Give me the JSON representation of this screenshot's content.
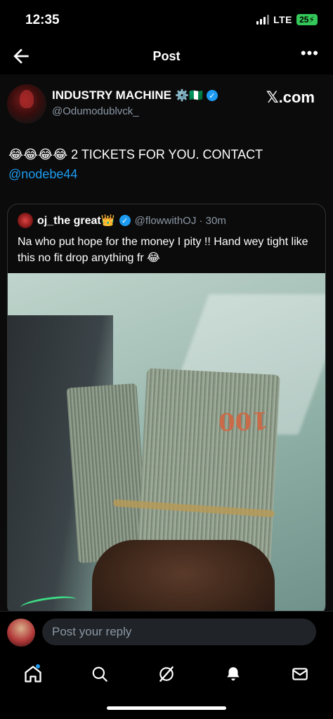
{
  "status_bar": {
    "time": "12:35",
    "network": "LTE",
    "battery": "25"
  },
  "nav": {
    "title": "Post"
  },
  "post": {
    "display_name": "INDUSTRY MACHINE",
    "name_emojis": "⚙️🇳🇬",
    "handle": "@Odumodublvck_",
    "watermark": "𝕏.com",
    "text": "😂😂😂😂 2 TICKETS FOR YOU. CONTACT",
    "mention": "@nodebe44"
  },
  "quote": {
    "name": "oj_the great👑",
    "handle_time": "@flowwithOJ · 30m",
    "text": "Na who put hope for the money I pity !! Hand wey tight like this no fit drop anything fr 😂",
    "bill_label": "100"
  },
  "reply": {
    "placeholder": "Post your reply"
  },
  "tabs": [
    "home",
    "search",
    "grok",
    "notifications",
    "messages"
  ],
  "colors": {
    "accent": "#1d9bf0",
    "background": "#000000",
    "muted": "#8b98a5"
  }
}
